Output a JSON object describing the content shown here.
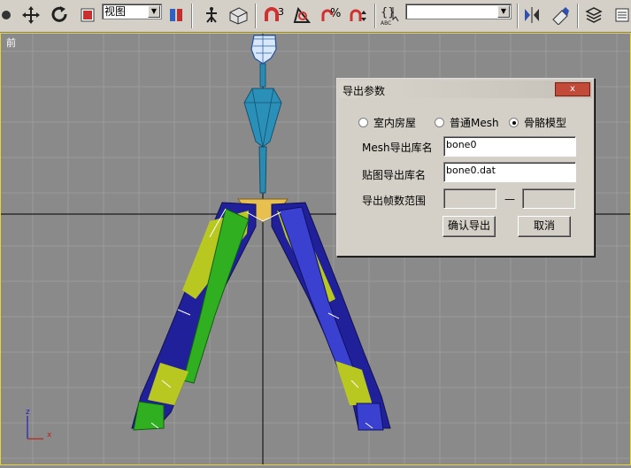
{
  "toolbar": {
    "view_combo": "视图",
    "snap_label": "3",
    "named_selection": "",
    "icons": [
      "select-icon",
      "move-icon",
      "rotate-icon",
      "scale-icon",
      "pivot-icon",
      "manipulate-icon",
      "keyboard-icon",
      "snap-icon",
      "angle-snap-icon",
      "percent-snap-icon",
      "spinner-snap-icon",
      "named-selection-icon",
      "mirror-icon",
      "align-icon",
      "layers-icon",
      "graph-icon"
    ]
  },
  "viewport": {
    "label": "前",
    "axis_z": "z",
    "axis_x": "x"
  },
  "dialog": {
    "title": "导出参数",
    "close": "x",
    "radios": [
      {
        "label": "室内房屋",
        "checked": false
      },
      {
        "label": "普通Mesh",
        "checked": false
      },
      {
        "label": "骨骼模型",
        "checked": true
      }
    ],
    "mesh_label": "Mesh导出库名",
    "mesh_value": "bone0",
    "texture_label": "贴图导出库名",
    "texture_value": "bone0.dat",
    "frames_label": "导出帧数范围",
    "frames_from": "",
    "frames_dash": "—",
    "frames_to": "",
    "confirm": "确认导出",
    "cancel": "取消"
  }
}
